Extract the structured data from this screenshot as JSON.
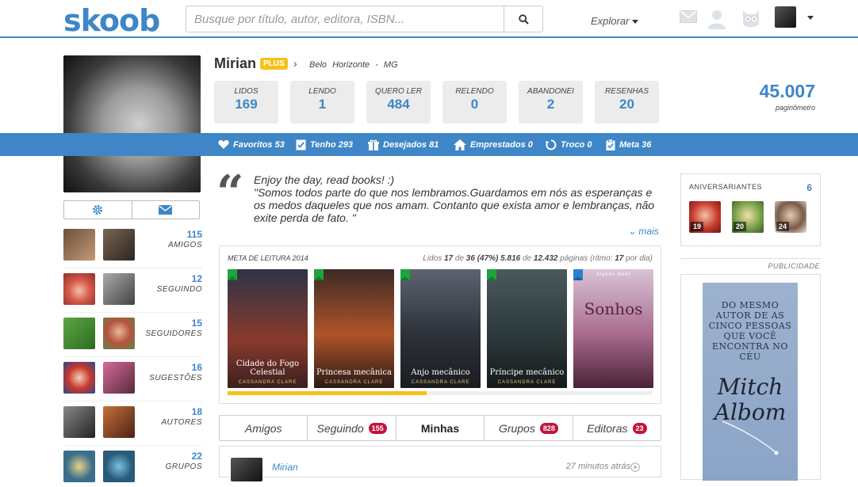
{
  "header": {
    "logo": "skoob",
    "search_placeholder": "Busque por título, autor, editora, ISBN...",
    "explore_label": "Explorar",
    "icons": [
      "mail-icon",
      "user-icon",
      "owl-icon",
      "avatar",
      "caret-down-icon"
    ]
  },
  "profile": {
    "name": "Mirian",
    "plan": "PLUS",
    "location": "Belo Horizonte - MG"
  },
  "stats": [
    {
      "label": "LIDOS",
      "value": "169"
    },
    {
      "label": "LENDO",
      "value": "1"
    },
    {
      "label": "QUERO LER",
      "value": "484"
    },
    {
      "label": "RELENDO",
      "value": "0"
    },
    {
      "label": "ABANDONEI",
      "value": "2"
    },
    {
      "label": "RESENHAS",
      "value": "20"
    }
  ],
  "paginometro": {
    "value": "45.007",
    "label": "paginômetro"
  },
  "bluebar": [
    {
      "label": "Favoritos 53",
      "icon": "heart-icon"
    },
    {
      "label": "Tenho 293",
      "icon": "checklist-icon"
    },
    {
      "label": "Desejados 81",
      "icon": "gift-icon"
    },
    {
      "label": "Emprestados 0",
      "icon": "house-icon"
    },
    {
      "label": "Troco 0",
      "icon": "swap-icon"
    },
    {
      "label": "Meta 36",
      "icon": "clipboard-icon"
    }
  ],
  "sidebar": [
    {
      "count": "115",
      "label": "AMIGOS"
    },
    {
      "count": "12",
      "label": "SEGUINDO"
    },
    {
      "count": "15",
      "label": "SEGUIDORES"
    },
    {
      "count": "16",
      "label": "SUGESTÕES"
    },
    {
      "count": "18",
      "label": "AUTORES"
    },
    {
      "count": "22",
      "label": "GRUPOS"
    }
  ],
  "quote": {
    "line1": "Enjoy the day, read books! :)",
    "line2": "\"Somos todos parte do que nos lembramos.Guardamos em nós as esperanças e os medos daqueles que nos amam. Contanto que exista amor e lembranças, não exite perda de fato. \"",
    "more": "mais"
  },
  "meta": {
    "title": "META DE LEITURA 2014",
    "read_prefix": "Lidos",
    "read": "17",
    "read_of": "de",
    "goal": "36",
    "percent": "(47%)",
    "pages": "5.816",
    "pages_of": "de",
    "pages_total": "12.432",
    "pages_suffix": "páginas (ritmo:",
    "rhythm": "17",
    "rhythm_suffix": "por dia)",
    "progress_fraction": 0.47,
    "books": [
      {
        "title": "Cidade do Fogo Celestial",
        "author": "CASSANDRA CLARE",
        "flag": "#1fa33c",
        "bg": "linear-gradient(180deg,#2c3446,#8a3a2c 60%,#3a1f1e)"
      },
      {
        "title": "Princesa mecânica",
        "author": "CASSANDRA CLARE",
        "flag": "#1fa33c",
        "bg": "linear-gradient(180deg,#3b2a24,#b0542a 55%,#2a1a16)"
      },
      {
        "title": "Anjo mecânico",
        "author": "CASSANDRA CLARE",
        "flag": "#1fa33c",
        "bg": "linear-gradient(180deg,#5d6470,#2d3139 55%,#1a1c20)"
      },
      {
        "title": "Príncipe mecânico",
        "author": "CASSANDRA CLARE",
        "flag": "#1fa33c",
        "bg": "linear-gradient(180deg,#4a5a5c,#2d3a3c 55%,#14191a)"
      },
      {
        "title": "Sonhos",
        "author": "Alyson Noël",
        "flag": "#2a7fd0",
        "bg": "linear-gradient(180deg,#d9c4d6,#a86a8c 55%,#4a2238)"
      }
    ]
  },
  "tabs": [
    {
      "label": "Amigos",
      "badge": ""
    },
    {
      "label": "Seguindo",
      "badge": "155"
    },
    {
      "label": "Minhas",
      "badge": ""
    },
    {
      "label": "Grupos",
      "badge": "828"
    },
    {
      "label": "Editoras",
      "badge": "23"
    }
  ],
  "feed": {
    "name": "Mirian",
    "time": "27 minutos atrás"
  },
  "birthdays": {
    "title": "ANIVERSARIANTES",
    "count": "6",
    "people": [
      {
        "day": "19"
      },
      {
        "day": "20"
      },
      {
        "day": "24"
      }
    ]
  },
  "ad": {
    "label": "PUBLICIDADE",
    "text": "DO MESMO AUTOR DE AS CINCO PESSOAS QUE VOCÊ ENCONTRA NO CÉU",
    "author": "Mitch Albom"
  },
  "colors": {
    "brand": "#3f86c7",
    "plus": "#f6c21a",
    "badge": "#c0143c"
  }
}
